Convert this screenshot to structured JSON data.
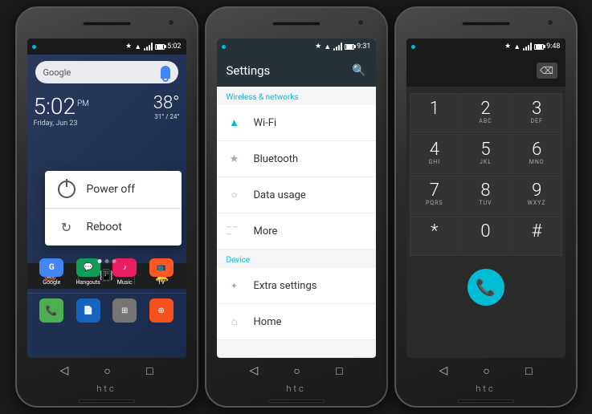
{
  "phones": [
    {
      "id": "phone1",
      "screen": "home",
      "status_bar": {
        "left_dot": true,
        "icons": [
          "bluetooth",
          "wifi",
          "signal",
          "battery"
        ],
        "time": "5:02"
      },
      "search_bar": {
        "text": "Google",
        "has_mic": true
      },
      "clock": {
        "time": "5:02",
        "ampm": "PM",
        "date": "Friday, Jun 23"
      },
      "weather": {
        "temp": "38°",
        "range": "31° / 24°"
      },
      "power_menu": {
        "visible": true,
        "items": [
          {
            "id": "power-off",
            "label": "Power off",
            "icon": "power"
          },
          {
            "id": "reboot",
            "label": "Reboot",
            "icon": "reboot"
          }
        ]
      },
      "sound_bar": {
        "icons": [
          "mute",
          "vibrate",
          "ring"
        ]
      },
      "app_row": [
        {
          "label": "Google",
          "color": "#4285f4"
        },
        {
          "label": "Hangouts",
          "color": "#0f9d58"
        },
        {
          "label": "Music",
          "color": "#e91e63"
        },
        {
          "label": "TV",
          "color": "#ff5722"
        }
      ],
      "dock": [
        {
          "label": "Phone",
          "color": "#4caf50"
        },
        {
          "label": "Docs",
          "color": "#1565c0"
        },
        {
          "label": "Apps",
          "color": "#757575"
        },
        {
          "label": "Chrome",
          "color": "#f4511e"
        }
      ],
      "htc_logo": "htc"
    },
    {
      "id": "phone2",
      "screen": "settings",
      "status_bar": {
        "icons": [
          "bluetooth",
          "wifi",
          "signal",
          "battery"
        ],
        "time": "9:31"
      },
      "header": {
        "title": "Settings",
        "has_search": true
      },
      "sections": [
        {
          "title": "Wireless & networks",
          "items": [
            {
              "icon": "wifi",
              "label": "Wi-Fi",
              "icon_color": "#00bcd4"
            },
            {
              "icon": "bluetooth",
              "label": "Bluetooth",
              "icon_color": "#aaa"
            },
            {
              "icon": "data",
              "label": "Data usage",
              "icon_color": "#aaa"
            },
            {
              "icon": "more",
              "label": "More",
              "icon_color": "#aaa"
            }
          ]
        },
        {
          "title": "Device",
          "items": [
            {
              "icon": "extra",
              "label": "Extra settings",
              "icon_color": "#aaa"
            },
            {
              "icon": "home",
              "label": "Home",
              "icon_color": "#aaa"
            }
          ]
        }
      ],
      "htc_logo": "htc"
    },
    {
      "id": "phone3",
      "screen": "dialer",
      "status_bar": {
        "icons": [
          "bluetooth",
          "wifi",
          "signal",
          "battery"
        ],
        "time": "9:48"
      },
      "keypad": [
        {
          "num": "1",
          "letters": ""
        },
        {
          "num": "2",
          "letters": "ABC"
        },
        {
          "num": "3",
          "letters": "DEF"
        },
        {
          "num": "4",
          "letters": "GHI"
        },
        {
          "num": "5",
          "letters": "JKL"
        },
        {
          "num": "6",
          "letters": "MNO"
        },
        {
          "num": "7",
          "letters": "PQRS"
        },
        {
          "num": "8",
          "letters": "TUV"
        },
        {
          "num": "9",
          "letters": "WXYZ"
        },
        {
          "num": "*",
          "letters": ""
        },
        {
          "num": "0",
          "letters": ""
        },
        {
          "num": "#",
          "letters": ""
        }
      ],
      "call_button": "📞",
      "htc_logo": "htc"
    }
  ]
}
